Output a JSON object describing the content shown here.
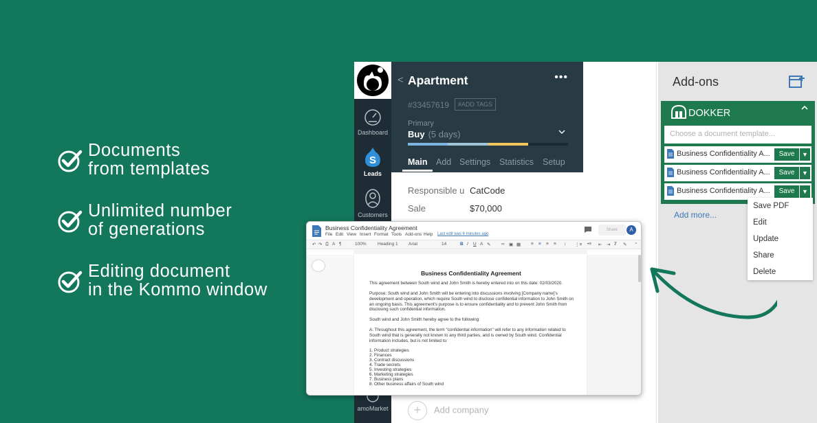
{
  "features": [
    {
      "line1": "Documents",
      "line2": "from templates"
    },
    {
      "line1": "Unlimited number",
      "line2": "of generations"
    },
    {
      "line1": "Editing document",
      "line2": "in the Kommo window"
    }
  ],
  "nav": {
    "items": [
      {
        "label": "Dashboard",
        "icon": "gauge-icon"
      },
      {
        "label": "Leads",
        "icon": "dollar-drop-icon"
      },
      {
        "label": "Customers",
        "icon": "customers-icon"
      },
      {
        "label": "amoMarket",
        "icon": "market-icon"
      }
    ]
  },
  "lead": {
    "back_glyph": "<",
    "title": "Apartment",
    "more_glyph": "•••",
    "id": "#33457619",
    "add_tags": "#ADD TAGS",
    "pipeline": "Primary",
    "stage": "Buy",
    "stage_days": "(5 days)",
    "tabs": [
      "Main",
      "Add",
      "Settings",
      "Statistics",
      "Setup"
    ],
    "fields": [
      {
        "label": "Responsible u",
        "value": "CatCode"
      },
      {
        "label": "Sale",
        "value": "$70,000"
      }
    ],
    "add_company": "Add company",
    "progress": [
      {
        "fraction": 0.25,
        "color": "#7cb3e0"
      },
      {
        "fraction": 0.25,
        "color": "#9fc5d8"
      },
      {
        "fraction": 0.25,
        "color": "#f2c65a"
      }
    ]
  },
  "addons": {
    "title": "Add-ons",
    "dokker_name": "DOKKER",
    "select_placeholder": "Choose a document template...",
    "templates": [
      {
        "name": "Business Confidentiality A...",
        "save": "Save"
      },
      {
        "name": "Business Confidentiality A...",
        "save": "Save"
      },
      {
        "name": "Business Confidentiality A...",
        "save": "Save"
      }
    ],
    "add_more": "Add more...",
    "menu": [
      "Save PDF",
      "Edit",
      "Update",
      "Share",
      "Delete"
    ]
  },
  "editor": {
    "title": "Business Confidentiality Agreement",
    "menus": [
      "File",
      "Edit",
      "View",
      "Insert",
      "Format",
      "Tools",
      "Add-ons",
      "Help"
    ],
    "last_edit": "Last edit was 6 minutes ago",
    "share": "Share",
    "avatar": "A",
    "toolbar": {
      "zoom": "100%",
      "style": "Heading 1",
      "font": "Arial",
      "size": "14"
    },
    "doc_heading": "Business Confidentiality Agreement",
    "paragraphs": [
      "This agreement between South wind and John Smith is hereby entered into on this date: 02/03/2020.",
      "Purpose: South wind and John Smith will be entering into discussions involving [Company name]'s development and operation, which require South wind to disclose confidential information to John Smith on an ongoing basis. This agreement's purpose is to ensure confidentiality and to prevent John Smith from disclosing such confidential information.",
      "South wind and John Smith hereby agree to the following:",
      "A: Throughout this agreement, the term \"confidential information\" will refer to any information related to South wind that is generally not known to any third parties, and is owned by South wind. Confidential information includes, but is not limited to:"
    ],
    "list": [
      "1.  Product strategies",
      "2.  Finances",
      "3.  Contract discussions",
      "4.  Trade secrets",
      "5.  Investing strategies",
      "6.  Marketing strategies",
      "7.  Business plans",
      "8.  Other business affairs of South wind"
    ]
  },
  "colors": {
    "background": "#13775c",
    "sidebar": "#1e2d35",
    "card_header": "#283b44",
    "dokker": "#1e7a4e",
    "link": "#3d78b8"
  }
}
